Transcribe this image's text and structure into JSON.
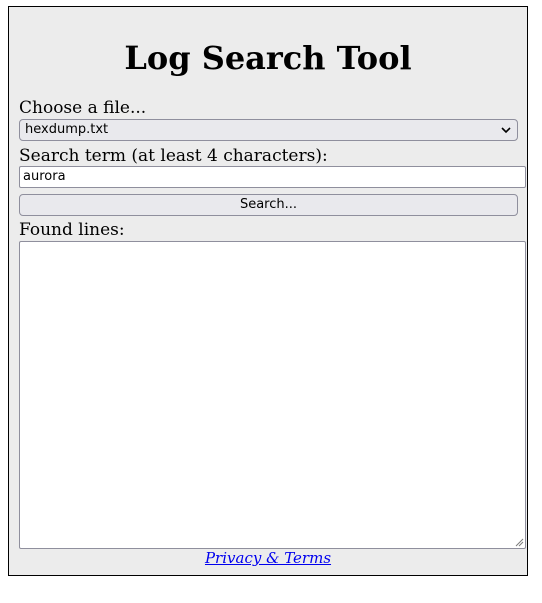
{
  "app": {
    "title": "Log Search Tool"
  },
  "file_picker": {
    "label": "Choose a file...",
    "selected": "hexdump.txt"
  },
  "search": {
    "label": "Search term (at least 4 characters):",
    "value": "aurora",
    "button_label": "Search..."
  },
  "results": {
    "label": "Found lines:",
    "content": ""
  },
  "footer": {
    "link_text": "Privacy & Terms"
  },
  "colors": {
    "panel_background": "#ececec",
    "control_background": "#e9e9ed",
    "link": "#0000ee"
  }
}
